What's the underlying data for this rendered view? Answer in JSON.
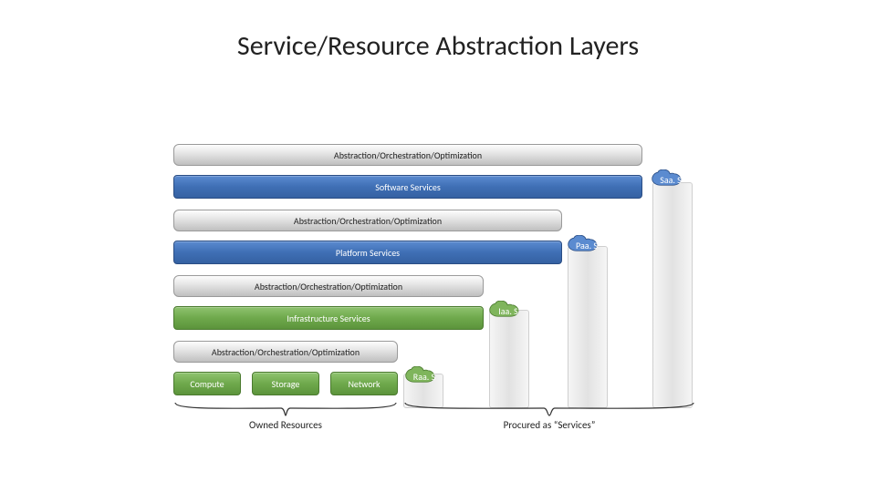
{
  "title": "Service/Resource Abstraction Layers",
  "abar_label": "Abstraction/Orchestration/Optimization",
  "software_services": "Software Services",
  "platform_services": "Platform Services",
  "infrastructure_services": "Infrastructure Services",
  "compute": "Compute",
  "storage": "Storage",
  "network": "Network",
  "saas": "Saa. S",
  "paas": "Paa. S",
  "iaas": "Iaa. S",
  "raas": "Raa. S",
  "owned": "Owned Resources",
  "procured": "Procured as “Services”"
}
